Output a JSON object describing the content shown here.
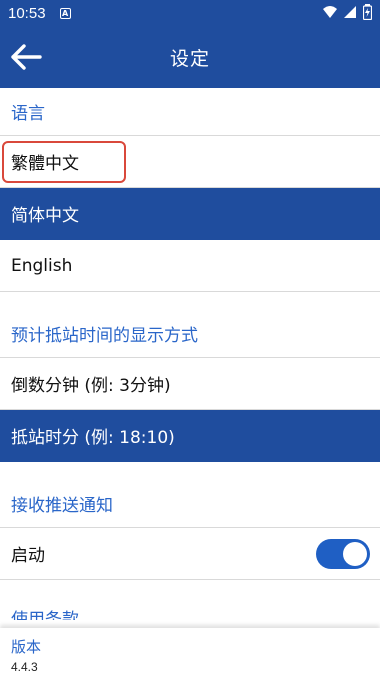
{
  "status_bar": {
    "time": "10:53",
    "notification_glyph": "A"
  },
  "app_bar": {
    "title": "设定"
  },
  "sections": {
    "language": {
      "header": "语言",
      "options": [
        "繁體中文",
        "简体中文",
        "English"
      ],
      "selected": "简体中文"
    },
    "arrival_display": {
      "header": "预计抵站时间的显示方式",
      "options": [
        "倒数分钟 (例: 3分钟)",
        "抵站时分 (例: 18:10)"
      ],
      "selected": "抵站时分 (例: 18:10)"
    },
    "push": {
      "header": "接收推送通知",
      "toggle_label": "启动",
      "enabled": true
    },
    "terms": {
      "header": "使用条款"
    }
  },
  "footer": {
    "version_label": "版本",
    "version_value": "4.4.3"
  },
  "colors": {
    "primary": "#1f4d9e",
    "accent": "#2a66c9",
    "highlight_box": "#d9483b"
  }
}
